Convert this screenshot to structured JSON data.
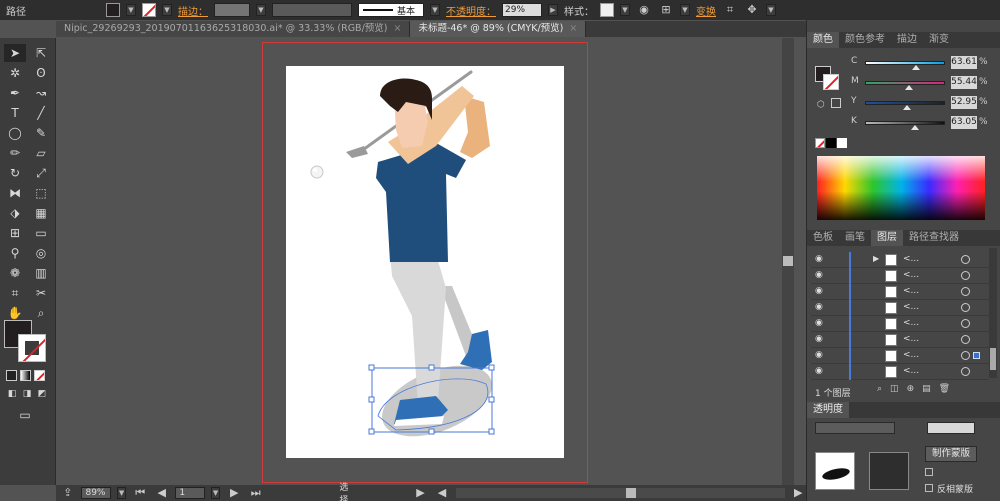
{
  "control_bar": {
    "path_label": "路径",
    "stroke_label": "描边：",
    "basic_label": "基本",
    "opacity_label": "不透明度：",
    "opacity_value": "29%",
    "style_label": "样式：",
    "transform_label": "变换"
  },
  "tabs": [
    {
      "label": "Nipic_29269293_20190701163625318030.ai* @ 33.33% (RGB/预览)",
      "close": "×"
    },
    {
      "label": "未标题-46* @ 89% (CMYK/预览)",
      "close": "×"
    }
  ],
  "colors": {
    "fill": "#231f20",
    "stroke_none": "#e0202a",
    "accent_orange": "#f09a3a",
    "selection_blue": "#4a7ad8",
    "artboard_frame": "#d23a3a"
  },
  "status": {
    "zoom": "89%",
    "page": "1",
    "tool_mode": "选择"
  },
  "color_panel": {
    "tabs": [
      "颜色",
      "颜色参考",
      "描边",
      "渐变"
    ],
    "channels": [
      {
        "name": "C",
        "value": "63.61",
        "fraction": 0.64
      },
      {
        "name": "M",
        "value": "55.44",
        "fraction": 0.55
      },
      {
        "name": "Y",
        "value": "52.95",
        "fraction": 0.53
      },
      {
        "name": "K",
        "value": "63.05",
        "fraction": 0.63
      }
    ],
    "unit": "%"
  },
  "layers_panel": {
    "tabs": [
      "色板",
      "画笔",
      "图层",
      "路径查找器"
    ],
    "rows": [
      {
        "name": "<...",
        "selected": false
      },
      {
        "name": "<...",
        "selected": false
      },
      {
        "name": "<...",
        "selected": false
      },
      {
        "name": "<...",
        "selected": false
      },
      {
        "name": "<...",
        "selected": false
      },
      {
        "name": "<...",
        "selected": false
      },
      {
        "name": "<...",
        "selected": true
      },
      {
        "name": "<...",
        "selected": false
      }
    ],
    "count_label": "1 个图层"
  },
  "transparency_panel": {
    "title": "透明度",
    "make_mask": "制作蒙版",
    "invert_mask": "反相蒙版"
  }
}
